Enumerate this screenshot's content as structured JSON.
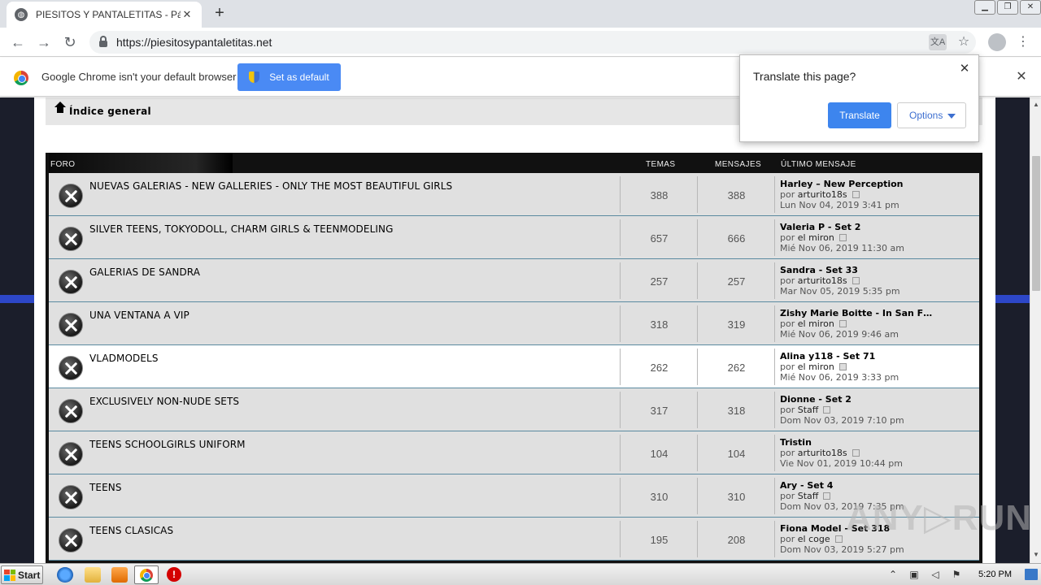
{
  "browser": {
    "tab_title": "PIESITOS Y PANTALETITAS - Página",
    "tab_close": "✕",
    "new_tab": "+",
    "url": "https://piesitosypantaletitas.net",
    "win_min": "▁",
    "win_max": "❐",
    "win_close": "✕"
  },
  "infobar": {
    "message": "Google Chrome isn't your default browser",
    "button": "Set as default",
    "close": "✕"
  },
  "translate": {
    "title": "Translate this page?",
    "translate_button": "Translate",
    "options_button": "Options",
    "close": "✕",
    "clipped": "n"
  },
  "breadcrumb": {
    "label": "Índice general"
  },
  "table": {
    "headers": {
      "forum": "FORO",
      "topics": "TEMAS",
      "posts": "MENSAJES",
      "last": "ÚLTIMO MENSAJE"
    },
    "rows": [
      {
        "title": "NUEVAS GALERIAS - NEW GALLERIES - ONLY THE MOST BEAUTIFUL GIRLS",
        "topics": "388",
        "posts": "388",
        "last_title": "Harley – New Perception",
        "by": "por",
        "user": "arturito18s",
        "date": "Lun Nov 04, 2019 3:41 pm"
      },
      {
        "title": "SILVER TEENS, TOKYODOLL, CHARM GIRLS & TEENMODELING",
        "topics": "657",
        "posts": "666",
        "last_title": "Valeria P - Set 2",
        "by": "por",
        "user": "el miron",
        "date": "Mié Nov 06, 2019 11:30 am"
      },
      {
        "title": "GALERIAS DE SANDRA",
        "topics": "257",
        "posts": "257",
        "last_title": "Sandra - Set 33",
        "by": "por",
        "user": "arturito18s",
        "date": "Mar Nov 05, 2019 5:35 pm"
      },
      {
        "title": "UNA VENTANA A VIP",
        "topics": "318",
        "posts": "319",
        "last_title": "Zishy Marie Boitte - In San F…",
        "by": "por",
        "user": "el miron",
        "date": "Mié Nov 06, 2019 9:46 am"
      },
      {
        "title": "VLADMODELS",
        "topics": "262",
        "posts": "262",
        "last_title": "Alina y118 - Set 71",
        "by": "por",
        "user": "el miron",
        "date": "Mié Nov 06, 2019 3:33 pm"
      },
      {
        "title": "EXCLUSIVELY NON-NUDE SETS",
        "topics": "317",
        "posts": "318",
        "last_title": "Dionne - Set 2",
        "by": "por",
        "user": "Staff",
        "date": "Dom Nov 03, 2019 7:10 pm"
      },
      {
        "title": "TEENS SCHOOLGIRLS UNIFORM",
        "topics": "104",
        "posts": "104",
        "last_title": "Tristin",
        "by": "por",
        "user": "arturito18s",
        "date": "Vie Nov 01, 2019 10:44 pm"
      },
      {
        "title": "TEENS",
        "topics": "310",
        "posts": "310",
        "last_title": "Ary - Set 4",
        "by": "por",
        "user": "Staff",
        "date": "Dom Nov 03, 2019 7:35 pm"
      },
      {
        "title": "TEENS CLASICAS",
        "topics": "195",
        "posts": "208",
        "last_title": "Fiona Model - Set 318",
        "by": "por",
        "user": "el coge",
        "date": "Dom Nov 03, 2019 5:27 pm"
      }
    ]
  },
  "watermark": "ANY▷RUN",
  "taskbar": {
    "start": "Start",
    "clock": "5:20 PM",
    "stop_glyph": "!"
  },
  "colors": {
    "accent_blue": "#4a8af4",
    "row_bg": "#e0e0e0",
    "row_highlight": "#ffffff",
    "header_bg": "#111111"
  }
}
